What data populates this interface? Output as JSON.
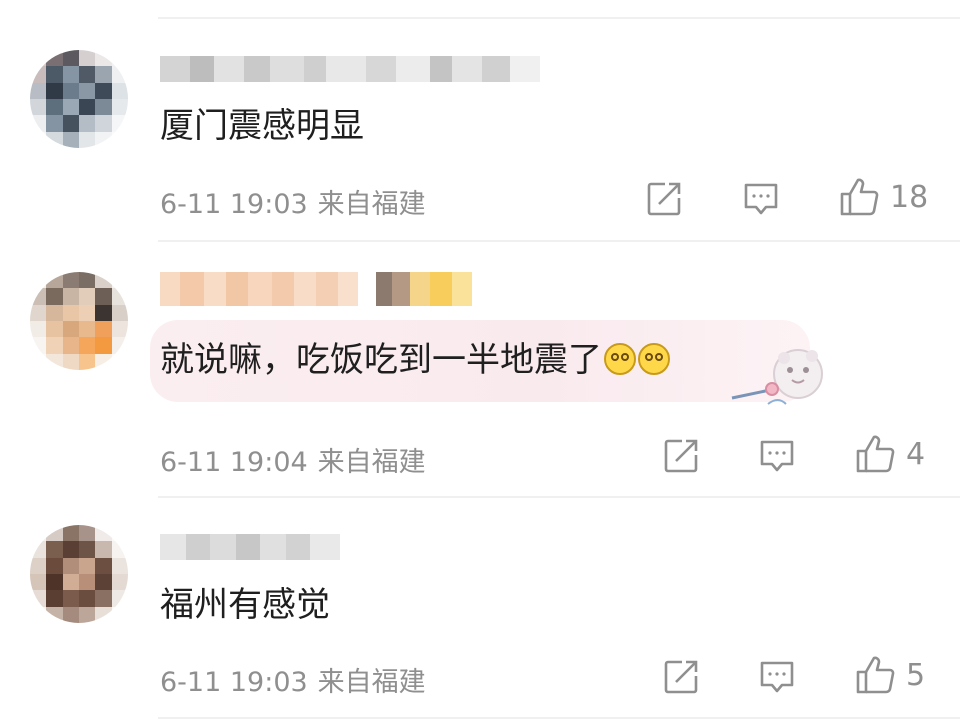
{
  "comments": [
    {
      "text": "厦门震感明显",
      "date": "6-11 19:03",
      "location": "来自福建",
      "likes": "18",
      "icons": {
        "share": "share-icon",
        "reply": "comment-icon",
        "like": "thumbs-up-icon"
      }
    },
    {
      "text": "就说嘛，吃饭吃到一半地震了",
      "emoji": [
        "dizzy-face-emoji",
        "dizzy-face-emoji"
      ],
      "date": "6-11 19:04",
      "location": "来自福建",
      "likes": "4",
      "icons": {
        "share": "share-icon",
        "reply": "comment-icon",
        "like": "thumbs-up-icon"
      }
    },
    {
      "text": "福州有感觉",
      "date": "6-11 19:03",
      "location": "来自福建",
      "likes": "5",
      "icons": {
        "share": "share-icon",
        "reply": "comment-icon",
        "like": "thumbs-up-icon"
      }
    }
  ],
  "colors": {
    "meta_text": "#8f8f8f",
    "body_text": "#1f1f1f",
    "bubble_bg": "#fbeef0",
    "divider": "#f0f0f0"
  }
}
